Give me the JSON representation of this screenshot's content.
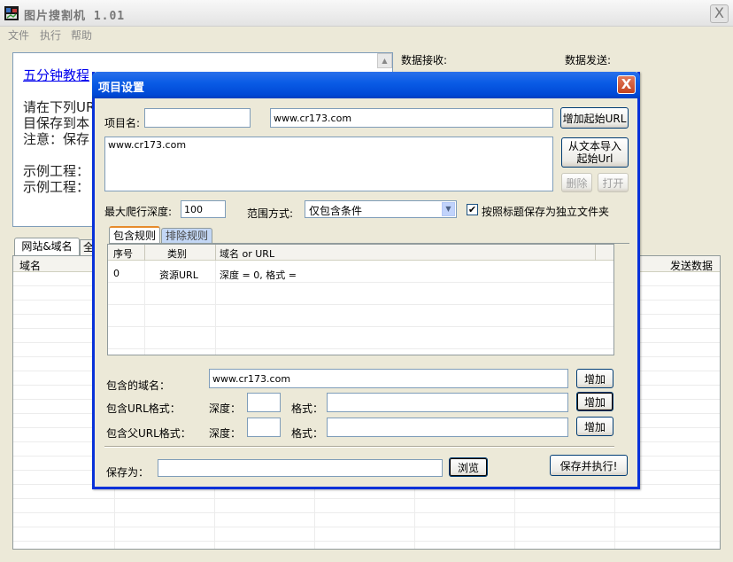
{
  "main_window": {
    "title": "图片搜割机 1.01",
    "close_label": "X"
  },
  "menu": {
    "items": [
      "文件",
      "执行",
      "帮助"
    ]
  },
  "tutorial": {
    "link": "五分钟教程",
    "lines": [
      "请在下列URL",
      "目保存到本",
      "注意：保存",
      "示例工程：",
      "示例工程："
    ]
  },
  "data_panel": {
    "receive_label": "数据接收:",
    "send_label": "数据发送:"
  },
  "main_tabs": {
    "site_domain": "网站&域名",
    "second": "全"
  },
  "main_list": {
    "col_domain": "域名",
    "col_send": "发送数据"
  },
  "dialog": {
    "title": "项目设置",
    "close_label": "X",
    "project_name_label": "项目名:",
    "project_name_value": "",
    "url_input_value": "www.cr173.com",
    "add_start_url_label": "增加起始URL",
    "url_list_value": "www.cr173.com",
    "import_text_label_1": "从文本导入",
    "import_text_label_2": "起始Url",
    "delete_label": "删除",
    "open_label": "打开",
    "max_depth_label": "最大爬行深度:",
    "max_depth_value": "100",
    "range_mode_label": "范围方式:",
    "range_mode_value": "仅包含条件",
    "save_by_title_label": "按照标题保存为独立文件夹",
    "save_by_title_checked": "✔",
    "tabs": {
      "include": "包含规则",
      "exclude": "排除规则"
    },
    "rules_table": {
      "headers": [
        "序号",
        "类别",
        "域名 or URL"
      ],
      "rows": [
        {
          "index": "0",
          "type": "资源URL",
          "value": "深度 = 0, 格式 ="
        }
      ]
    },
    "include_domain_label": "包含的域名：",
    "include_domain_value": "www.cr173.com",
    "add_label": "增加",
    "include_url_format_label": "包含URL格式：",
    "include_parent_url_format_label": "包含父URL格式：",
    "depth_label": "深度：",
    "format_label": "格式：",
    "save_as_label": "保存为：",
    "save_as_value": "",
    "browse_label": "浏览",
    "save_execute_label": "保存并执行!"
  }
}
